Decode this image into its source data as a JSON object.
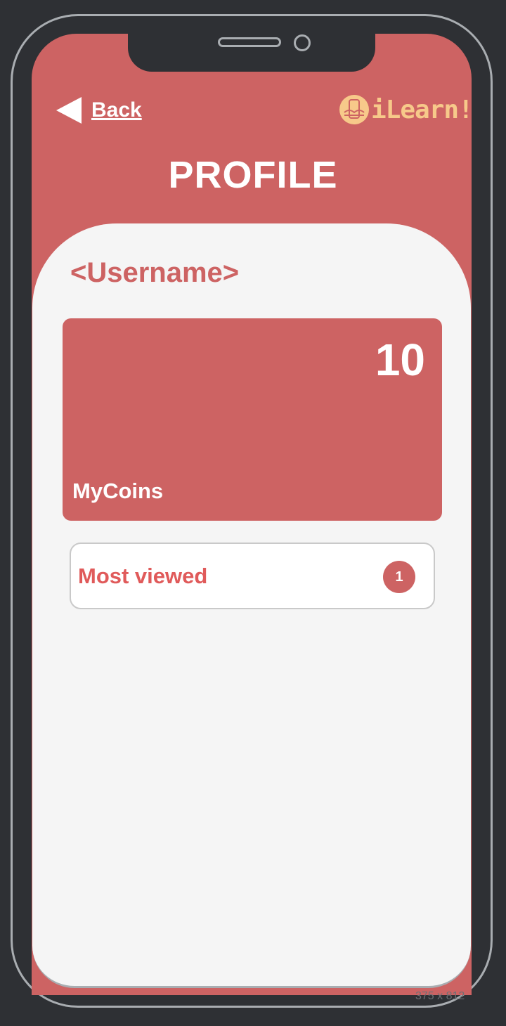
{
  "header": {
    "back_label": "Back",
    "logo_text": "iLearn!",
    "title": "PROFILE"
  },
  "profile": {
    "username": "<Username>"
  },
  "coins": {
    "value": "10",
    "label": "MyCoins"
  },
  "most_viewed": {
    "label": "Most viewed",
    "count": "1"
  },
  "device": {
    "dimensions_label": "375 x 812"
  },
  "colors": {
    "primary": "#cd6363",
    "accent": "#f7c98a",
    "background": "#f5f5f5",
    "device": "#2e3034"
  }
}
